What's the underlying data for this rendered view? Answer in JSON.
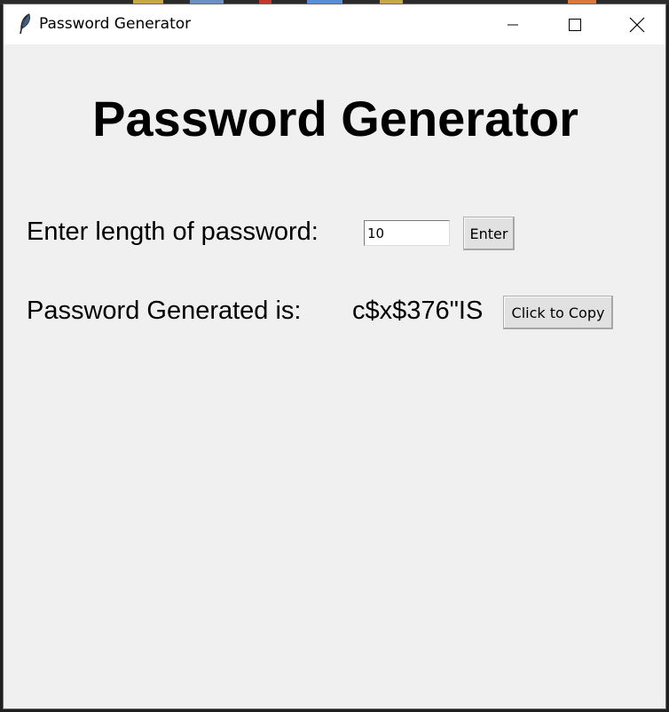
{
  "window": {
    "title": "Password Generator",
    "controls": {
      "minimize": "minimize-icon",
      "maximize": "maximize-icon",
      "close": "close-icon"
    }
  },
  "main": {
    "heading": "Password Generator",
    "length_label": "Enter length of password:",
    "length_value": "10",
    "enter_button": "Enter",
    "generated_label": "Password Generated is:",
    "generated_password": "c$x$376\"IS",
    "copy_button": "Click to Copy"
  },
  "icons": {
    "app": "feather-icon"
  },
  "colors": {
    "background": "#f0f0f0",
    "titlebar": "#ffffff",
    "button": "#e1e1e1",
    "text": "#000000"
  }
}
